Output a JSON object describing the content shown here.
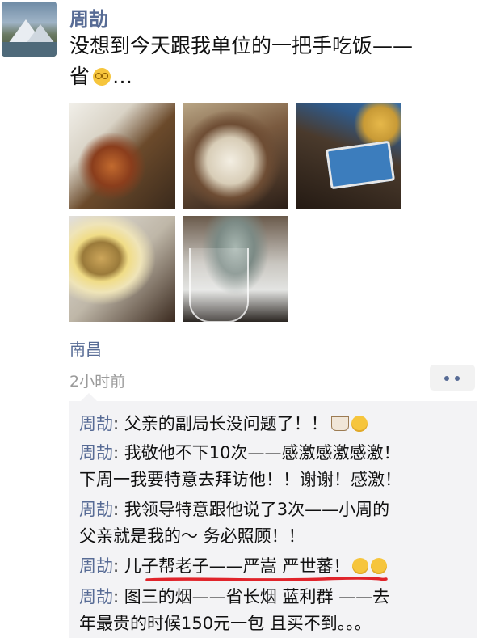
{
  "post": {
    "author": "周劼",
    "text_line1": "没想到今天跟我单位的一把手吃饭——",
    "text_line2_prefix": "省",
    "text_ellipsis": "…",
    "location": "南昌",
    "time": "2小时前"
  },
  "photos": [
    "food-photo-1",
    "food-photo-2",
    "cigarette-photo",
    "soup-photo",
    "glass-photo"
  ],
  "icons": {
    "more": "more-dots-icon",
    "emoji": "dizzy-face-icon",
    "tea": "tea-cup-icon",
    "smile": "smile-icon"
  },
  "comments": [
    {
      "author": "周劼",
      "sep": ": ",
      "lines": [
        "父亲的副局长没问题了！！"
      ]
    },
    {
      "author": "周劼",
      "sep": ": ",
      "lines": [
        "我敬他不下10次——感激感激感激！",
        "下周一我要特意去拜访他！！谢谢！感激！"
      ]
    },
    {
      "author": "周劼",
      "sep": ": ",
      "lines": [
        "我领导特意跟他说了3次——小周的",
        "父亲就是我的～ 务必照顾！！"
      ]
    },
    {
      "author": "周劼",
      "sep": ": ",
      "lines": [
        "儿子帮老子——严嵩 严世蕃！"
      ]
    },
    {
      "author": "周劼",
      "sep": ": ",
      "lines": [
        "图三的烟——省长烟 蓝利群 ——去",
        "年最贵的时候150元一包 且买不到。。。"
      ]
    }
  ],
  "colors": {
    "name": "#576b95",
    "text": "#111111",
    "meta": "#9a9a9a",
    "comment_bg": "#f3f3f5",
    "underline": "#e0242b"
  }
}
